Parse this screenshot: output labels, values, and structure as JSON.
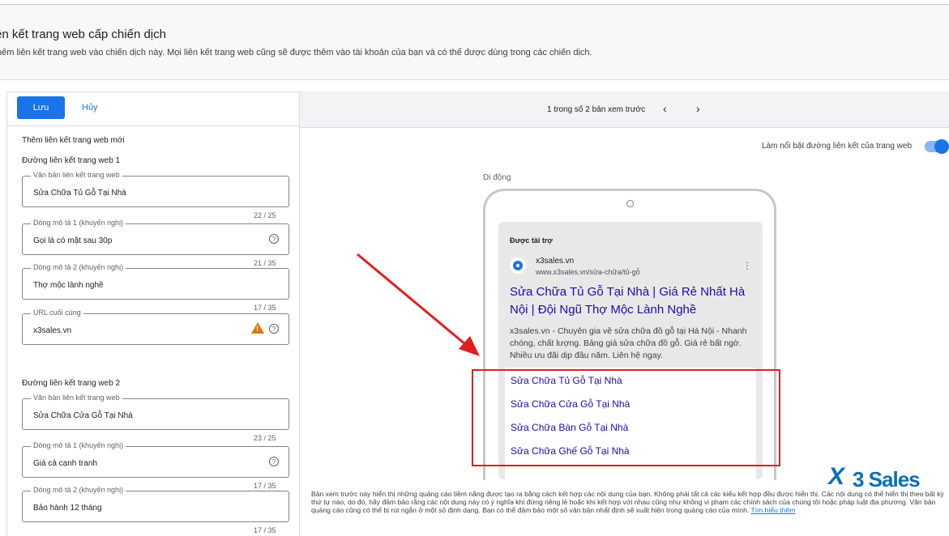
{
  "header": {
    "title": "ên kết trang web cấp chiến dịch",
    "description": "hêm liên kết trang web vào chiến dịch này. Mọi liên kết trang web cũng sẽ được thêm vào tài khoản của bạn và có thể được dùng trong các chiến dịch."
  },
  "toolbar": {
    "save_label": "Lưu",
    "cancel_label": "Hủy"
  },
  "form": {
    "new_title": "Thêm liên kết trang web mới",
    "sitelink1": {
      "title": "Đường liên kết trang web 1",
      "text_label": "Văn bản liên kết trang web",
      "text_value": "Sửa Chữa Tủ Gỗ Tại Nhà",
      "text_counter": "22 / 25",
      "desc1_label": "Dòng mô tả 1 (khuyến nghị)",
      "desc1_value": "Gọi là có mặt sau 30p",
      "desc1_counter": "21 / 35",
      "desc2_label": "Dòng mô tả 2 (khuyến nghị)",
      "desc2_value": "Thợ mộc lành nghề",
      "desc2_counter": "17 / 35",
      "url_label": "URL cuối cùng",
      "url_value": "x3sales.vn"
    },
    "sitelink2": {
      "title": "Đường liên kết trang web 2",
      "text_label": "Văn bản liên kết trang web",
      "text_value": "Sửa Chữa Cửa Gỗ Tại Nhà",
      "text_counter": "23 / 25",
      "desc1_label": "Dòng mô tả 1 (khuyến nghị)",
      "desc1_value": "Giá cả cạnh tranh",
      "desc1_counter": "17 / 35",
      "desc2_label": "Dòng mô tả 2 (khuyến nghị)",
      "desc2_value": "Bảo hành 12 tháng",
      "desc2_counter": "17 / 35"
    }
  },
  "preview": {
    "pager_text": "1 trong số 2 bản xem trước",
    "highlight_label": "Làm nổi bật đường liên kết của trang web",
    "highlight_on": true,
    "device_label": "Di động",
    "ad": {
      "sponsored": "Được tài trợ",
      "site_name": "x3sales.vn",
      "site_url": "www.x3sales.vn/sửa-chữa/tủ-gỗ",
      "title": "Sửa Chữa Tủ Gỗ Tại Nhà | Giá Rẻ Nhất Hà Nội | Đội Ngũ Thợ Mộc Lành Nghề",
      "description": "x3sales.vn - Chuyên gia về sửa chữa đồ gỗ tại Hà Nội - Nhanh chóng, chất lượng. Bảng giá sửa chữa đồ gỗ. Giá rẻ bất ngờ. Nhiều ưu đãi dịp đầu năm. Liên hệ ngay.",
      "sitelinks": [
        "Sửa Chữa Tủ Gỗ Tại Nhà",
        "Sửa Chữa Cửa Gỗ Tại Nhà",
        "Sửa Chữa Bàn Gỗ Tại Nhà",
        "Sửa Chữa Ghế Gỗ Tại Nhà"
      ]
    },
    "footer_text": "Bản xem trước này hiển thị những quảng cáo tiềm năng được tạo ra bằng cách kết hợp các nội dung của bạn. Không phải tất cả các kiểu kết hợp đều được hiển thị. Các nội dung có thể hiển thị theo bất kỳ thứ tự nào, do đó, hãy đảm bảo rằng các nội dung này có ý nghĩa khi đứng riêng lẻ hoặc khi kết hợp với nhau cũng như không vi phạm các chính sách của chúng tôi hoặc pháp luật địa phương. Văn bản quảng cáo cũng có thể bị rút ngắn ở một số định dạng. Bạn có thể đảm bảo một số văn bản nhất định sẽ xuất hiện trong quảng cáo của mình. ",
    "learn_more": "Tìm hiểu thêm"
  },
  "logo": {
    "mark": "X",
    "text": "3 Sales"
  },
  "colors": {
    "accent": "#1a73e8",
    "link": "#1a0dab",
    "annotation": "#e02020",
    "logo": "#0b6fb3"
  }
}
